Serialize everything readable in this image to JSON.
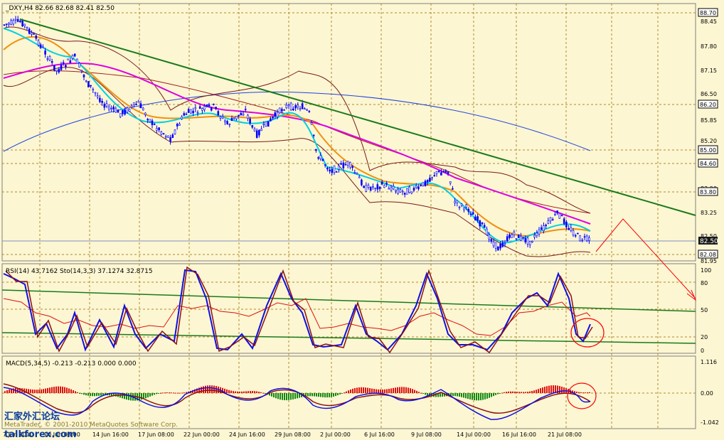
{
  "panels": {
    "main": {
      "title": "_DXY,H4  82.66 82.68 82.41 82.50",
      "price_labels": [
        "88.45",
        "87.80",
        "87.15",
        "86.50",
        "85.85",
        "85.20",
        "83.90",
        "83.25",
        "82.50",
        "81.95"
      ],
      "hline_labels": [
        "88.70",
        "86.20",
        "85.00",
        "84.60",
        "83.80",
        "82.08"
      ],
      "current_price": "82.50"
    },
    "rsi": {
      "title": "RSI(14) 43.7162  Sto(14,3,3) 37.1274 32.8715",
      "levels": [
        "100",
        "80",
        "50",
        "20",
        "0"
      ]
    },
    "macd": {
      "title": "MACD(5,34,5) -0.213 -0.213 0.000 0.000",
      "levels": [
        "1.116",
        "0.00",
        "-1.042"
      ]
    }
  },
  "time_axis": [
    "7 Jun 2010",
    "10 Jun 08:00",
    "14 Jun 16:00",
    "17 Jun 08:00",
    "22 Jun 00:00",
    "24 Jun 16:00",
    "29 Jun 08:00",
    "2 Jul 00:00",
    "6 Jul 16:00",
    "9 Jul 08:00",
    "14 Jul 00:00",
    "16 Jul 16:00",
    "21 Jul 08:00"
  ],
  "watermark": {
    "logo_text": "汇家外汇论坛",
    "copyright": "MetaTrader, © 2001-2010 MetaQuotes Software Corp.",
    "site": "talkforex.com"
  },
  "colors": {
    "background": "#fcf6d2",
    "grid": "#c0a050",
    "candle": "#0000ff",
    "trendline": "#1a7a1a",
    "ma_magenta": "#e000e0",
    "ma_orange": "#f0900f",
    "ma_cyan": "#00d0e0",
    "ma_blue": "#2244dd",
    "bollinger": "#7a1a1a",
    "projection": "#ff0000"
  }
}
